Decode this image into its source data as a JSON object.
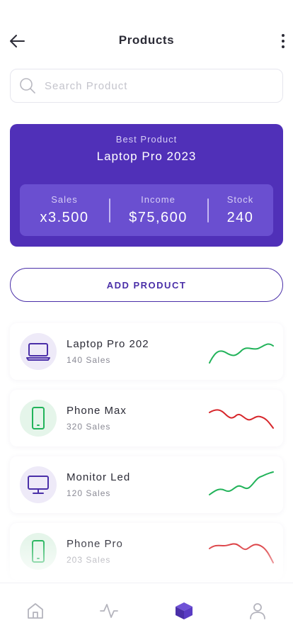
{
  "header": {
    "title": "Products",
    "back_icon": "arrow-left-icon",
    "menu_icon": "more-vertical-icon"
  },
  "search": {
    "placeholder": "Search Product",
    "value": "",
    "icon": "search-icon"
  },
  "best_product": {
    "label": "Best Product",
    "name": "Laptop Pro 2023",
    "stats": [
      {
        "label": "Sales",
        "value": "x3.500"
      },
      {
        "label": "Income",
        "value": "$75,600"
      },
      {
        "label": "Stock",
        "value": "240"
      }
    ]
  },
  "add_button": {
    "label": "ADD PRODUCT"
  },
  "products": [
    {
      "name": "Laptop Pro 202",
      "sales": "140 Sales",
      "icon": "laptop-icon",
      "trend": "up"
    },
    {
      "name": "Phone Max",
      "sales": "320 Sales",
      "icon": "phone-icon",
      "trend": "down"
    },
    {
      "name": "Monitor Led",
      "sales": "120 Sales",
      "icon": "monitor-icon",
      "trend": "up"
    },
    {
      "name": "Phone Pro",
      "sales": "203 Sales",
      "icon": "phone-icon",
      "trend": "down"
    }
  ],
  "bottom_nav": [
    {
      "icon": "home-icon",
      "active": false
    },
    {
      "icon": "activity-icon",
      "active": false
    },
    {
      "icon": "box-icon",
      "active": true
    },
    {
      "icon": "user-icon",
      "active": false
    }
  ],
  "colors": {
    "primary": "#5030b8",
    "primary_light": "#6a4fd0",
    "trend_up": "#22b35a",
    "trend_down": "#d7262b",
    "laptop_bg": "#eeeaf8",
    "phone_bg": "#e5f5ea"
  }
}
